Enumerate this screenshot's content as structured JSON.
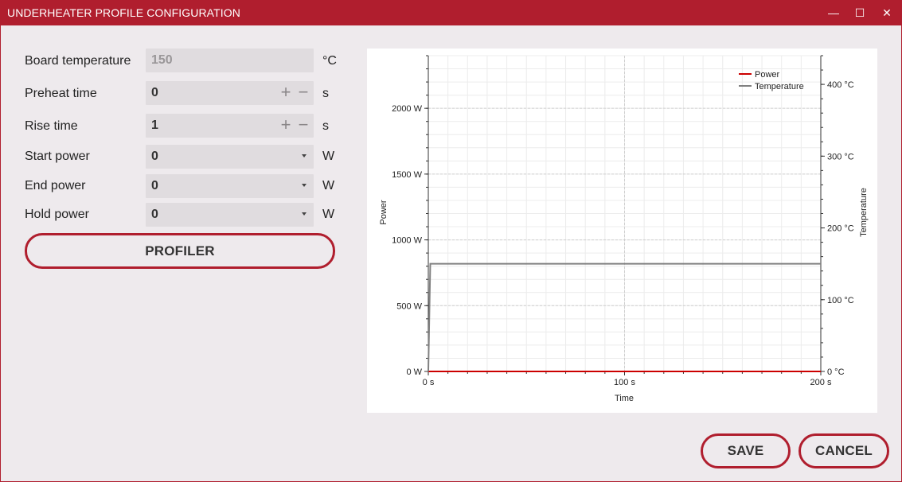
{
  "window": {
    "title": "UNDERHEATER PROFILE CONFIGURATION",
    "minimize_glyph": "—",
    "maximize_glyph": "☐",
    "close_glyph": "✕"
  },
  "form": {
    "board_temperature": {
      "label": "Board temperature",
      "value": "150",
      "unit": "°C"
    },
    "preheat_time": {
      "label": "Preheat time",
      "value": "0",
      "unit": "s"
    },
    "rise_time": {
      "label": "Rise time",
      "value": "1",
      "unit": "s"
    },
    "start_power": {
      "label": "Start power",
      "value": "0",
      "unit": "W"
    },
    "end_power": {
      "label": "End power",
      "value": "0",
      "unit": "W"
    },
    "hold_power": {
      "label": "Hold power",
      "value": "0",
      "unit": "W"
    },
    "plus_glyph": "+",
    "minus_glyph": "−"
  },
  "buttons": {
    "profiler": "PROFILER",
    "save": "SAVE",
    "cancel": "CANCEL"
  },
  "colors": {
    "accent": "#b01e2e",
    "power_series": "#cc0000",
    "temperature_series": "#808080"
  },
  "chart_data": {
    "type": "line",
    "xlabel": "Time",
    "ylabel": "Power",
    "y2label": "Temperature",
    "xlim": [
      0,
      200
    ],
    "ylim": [
      0,
      2400
    ],
    "y2lim": [
      0,
      440
    ],
    "x_ticks": [
      0,
      100,
      200
    ],
    "x_tick_labels": [
      "0 s",
      "100 s",
      "200 s"
    ],
    "y_ticks": [
      0,
      500,
      1000,
      1500,
      2000
    ],
    "y_tick_labels": [
      "0 W",
      "500 W",
      "1000 W",
      "1500 W",
      "2000 W"
    ],
    "y2_ticks": [
      0,
      100,
      200,
      300,
      400
    ],
    "y2_tick_labels": [
      "0 °C",
      "100 °C",
      "200 °C",
      "300 °C",
      "400 °C"
    ],
    "grid": true,
    "legend_position": "top-right",
    "series": [
      {
        "name": "Power",
        "axis": "left",
        "x": [
          0,
          200
        ],
        "y": [
          0,
          0
        ]
      },
      {
        "name": "Temperature",
        "axis": "right",
        "x": [
          0,
          1,
          200
        ],
        "y": [
          0,
          150,
          150
        ]
      }
    ]
  }
}
